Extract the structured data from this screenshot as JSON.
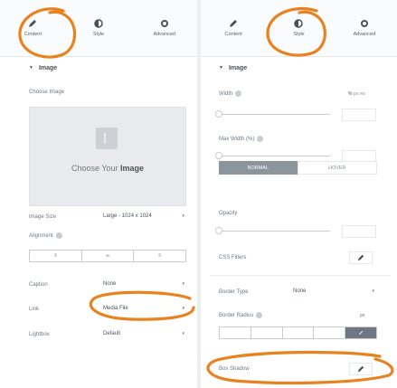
{
  "tabs": [
    {
      "label": "Content",
      "icon": "pencil-icon"
    },
    {
      "label": "Style",
      "icon": "half-circle-icon"
    },
    {
      "label": "Advanced",
      "icon": "gear-icon"
    }
  ],
  "left": {
    "section_title": "Image",
    "choose_image_label": "Choose Image",
    "placeholder_text": "Choose Your ",
    "placeholder_bold": "Image",
    "image_size_label": "Image Size",
    "image_size_value": "Large - 1024 x 1024",
    "alignment_label": "Alignment",
    "alignment_options": [
      "≡",
      "≐",
      "≡"
    ],
    "caption_label": "Caption",
    "caption_value": "None",
    "link_label": "Link",
    "link_value": "Media File",
    "lightbox_label": "Lightbox",
    "lightbox_value": "Default"
  },
  "right": {
    "section_title": "Image",
    "width_label": "Width",
    "width_unit": "%",
    "unit_options": [
      "px",
      "vw"
    ],
    "max_width_label": "Max Width (%)",
    "state_normal": "NORMAL",
    "state_hover": "HOVER",
    "opacity_label": "Opacity",
    "css_filters_label": "CSS Filters",
    "border_type_label": "Border Type",
    "border_type_value": "None",
    "border_radius_label": "Border Radius",
    "border_radius_unit": "px",
    "box_shadow_label": "Box Shadow"
  },
  "colors": {
    "annotation": "#e8821e",
    "active": "#6d7882"
  }
}
